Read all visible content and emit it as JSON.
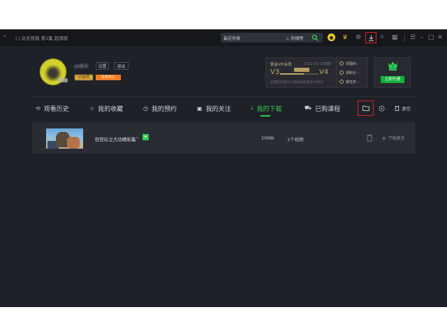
{
  "titlebar": {
    "back_label": "‹",
    "title": "| | 功夫熊猫 第1集 超清版",
    "search": {
      "value": "最近热搜",
      "hot_label": "热搜榜"
    },
    "icons": [
      "avatar-icon",
      "crown-icon",
      "gear-icon",
      "download-icon",
      "gamepad-icon",
      "apps-icon",
      "menu-icon",
      "minimize-icon",
      "maximize-icon",
      "close-icon"
    ]
  },
  "profile": {
    "username": "Jin陈洋",
    "settings_label": "设置",
    "logout_label": "退出",
    "level_badge": "V3会员",
    "task_center_label": "任务中心"
  },
  "vip_card": {
    "title": "黄金VIP会员",
    "date": "2022-01-23到期",
    "level_from": "V3",
    "level_to": "V4",
    "progress": 0.62,
    "desc": "还需成长值1523成长值升级至V4会员",
    "side_items": [
      "领福利 ›",
      "领积分 ›",
      "做任务 ›"
    ]
  },
  "open_card": {
    "button_label": "立即开通"
  },
  "tabs": [
    {
      "label": "观看历史",
      "icon": "⟲",
      "active": false
    },
    {
      "label": "我的收藏",
      "icon": "☆",
      "active": false
    },
    {
      "label": "我的预约",
      "icon": "◷",
      "active": false
    },
    {
      "label": "我的关注",
      "icon": "▣",
      "active": false
    },
    {
      "label": "我的下载",
      "icon": "⤓",
      "active": true
    },
    {
      "label": "已购课程",
      "icon": "⛟",
      "active": false
    }
  ],
  "toolbar": {
    "clear_label": "清空"
  },
  "downloads": [
    {
      "title": "狂狂队立大功精彩集",
      "size": "20MB",
      "count": "1个视频",
      "more_label": "下载更多"
    }
  ],
  "colors": {
    "accent": "#2ecc54",
    "highlight": "#e02020",
    "vip_gold": "#c4a963",
    "task_orange": "#f57c1f"
  }
}
